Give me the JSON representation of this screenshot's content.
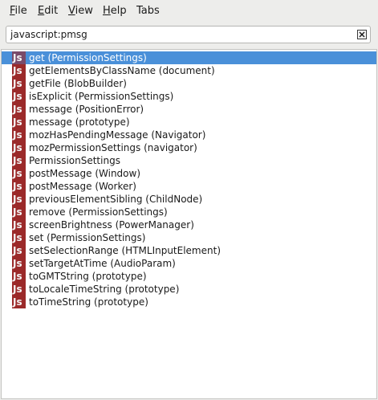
{
  "menubar": {
    "items": [
      {
        "ul": "F",
        "rest": "ile"
      },
      {
        "ul": "E",
        "rest": "dit"
      },
      {
        "ul": "V",
        "rest": "iew"
      },
      {
        "ul": "H",
        "rest": "elp"
      },
      {
        "ul": "",
        "rest": "Tabs"
      }
    ]
  },
  "search": {
    "value": "javascript:pmsg",
    "clear_icon": "clear-icon"
  },
  "results": {
    "icon_text": "Js",
    "selected_index": 0,
    "items": [
      "get (PermissionSettings)",
      "getElementsByClassName (document)",
      "getFile (BlobBuilder)",
      "isExplicit (PermissionSettings)",
      "message (PositionError)",
      "message (prototype)",
      "mozHasPendingMessage (Navigator)",
      "mozPermissionSettings (navigator)",
      "PermissionSettings",
      "postMessage (Window)",
      "postMessage (Worker)",
      "previousElementSibling (ChildNode)",
      "remove (PermissionSettings)",
      "screenBrightness (PowerManager)",
      "set (PermissionSettings)",
      "setSelectionRange (HTMLInputElement)",
      "setTargetAtTime (AudioParam)",
      "toGMTString (prototype)",
      "toLocaleTimeString (prototype)",
      "toTimeString (prototype)"
    ]
  },
  "colors": {
    "selection": "#4a90d9",
    "js_icon": "#9b2a2a"
  }
}
